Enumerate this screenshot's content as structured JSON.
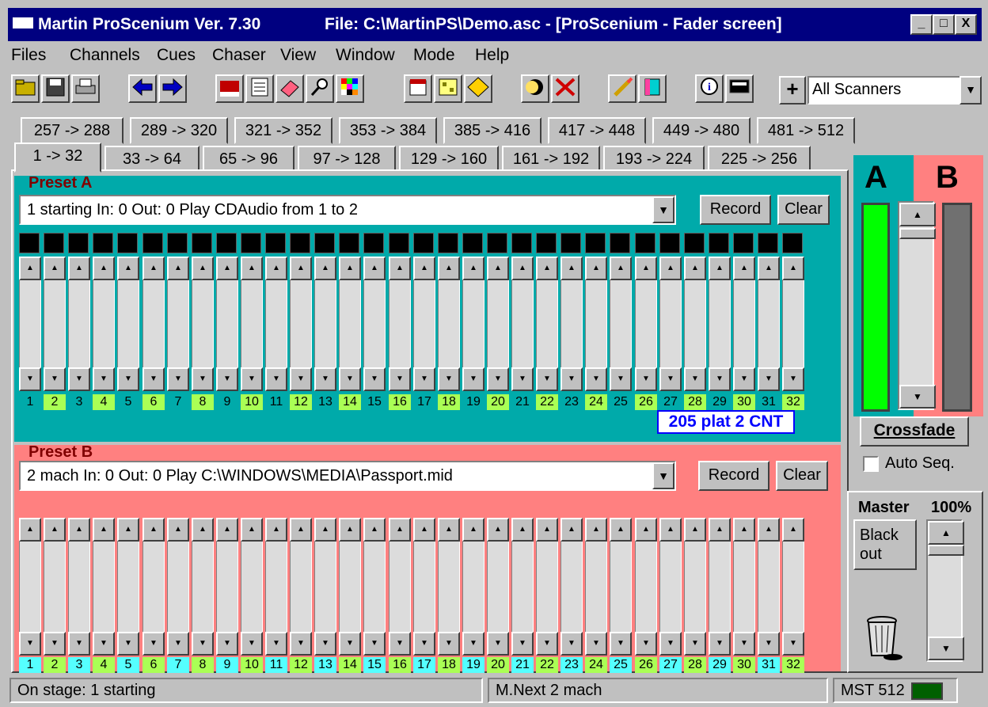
{
  "window": {
    "app_title": "Martin ProScenium Ver. 7.30",
    "file_title": "File: C:\\MartinPS\\Demo.asc - [ProScenium - Fader screen]",
    "min_label": "_",
    "max_label": "□",
    "close_label": "X"
  },
  "menu": [
    "Files",
    "Channels",
    "Cues",
    "Chaser",
    "View",
    "Window",
    "Mode",
    "Help"
  ],
  "toolbar": {
    "icons": [
      "open-folder-icon",
      "save-disk-icon",
      "printer-icon",
      "arrow-left-icon",
      "arrow-right-icon",
      "ml-icon",
      "list-icon",
      "eraser-icon",
      "magnify-icon",
      "color-grid-icon",
      "cue-card-icon",
      "network-icon",
      "sign-icon",
      "moon-icon",
      "cross-icon",
      "brush-icon",
      "fill-icon",
      "info-icon",
      "monitor-icon"
    ],
    "plus_label": "+",
    "scanner_value": "All Scanners"
  },
  "tabs": {
    "row_top": [
      "257 -> 288",
      "289 -> 320",
      "321 -> 352",
      "353 -> 384",
      "385 -> 416",
      "417 -> 448",
      "449 -> 480",
      "481 -> 512"
    ],
    "row_bottom": [
      "1 -> 32",
      "33 -> 64",
      "65 -> 96",
      "97 -> 128",
      "129 -> 160",
      "161 -> 192",
      "193 -> 224",
      "225 -> 256"
    ],
    "active": "1 -> 32"
  },
  "presetA": {
    "label": "Preset A",
    "cue": "1  starting In: 0 Out: 0  Play CDAudio from  1 to 2",
    "record_label": "Record",
    "clear_label": "Clear",
    "status_label": "205 plat 2 CNT"
  },
  "presetB": {
    "label": "Preset B",
    "cue": "2  mach In: 0 Out: 0  Play C:\\WINDOWS\\MEDIA\\Passport.mid",
    "record_label": "Record",
    "clear_label": "Clear"
  },
  "channels": [
    "1",
    "2",
    "3",
    "4",
    "5",
    "6",
    "7",
    "8",
    "9",
    "10",
    "11",
    "12",
    "13",
    "14",
    "15",
    "16",
    "17",
    "18",
    "19",
    "20",
    "21",
    "22",
    "23",
    "24",
    "25",
    "26",
    "27",
    "28",
    "29",
    "30",
    "31",
    "32"
  ],
  "crossfade": {
    "label_a": "A",
    "label_b": "B",
    "button_label": "Crossfade",
    "autoseq_label": "Auto Seq.",
    "level_a": 1.0,
    "level_b": 1.0
  },
  "master": {
    "label": "Master",
    "value": "100%",
    "blackout_label_1": "Black",
    "blackout_label_2": "out"
  },
  "status": {
    "on_stage": "On stage: 1  starting",
    "next": "M.Next 2  mach",
    "mst": "MST 512"
  },
  "colors": {
    "preset_a_bg": "#00aaaa",
    "preset_b_bg": "#ff8080",
    "title_bg": "#000080",
    "num_green": "#aaff55",
    "num_cyan": "#55ffff"
  }
}
